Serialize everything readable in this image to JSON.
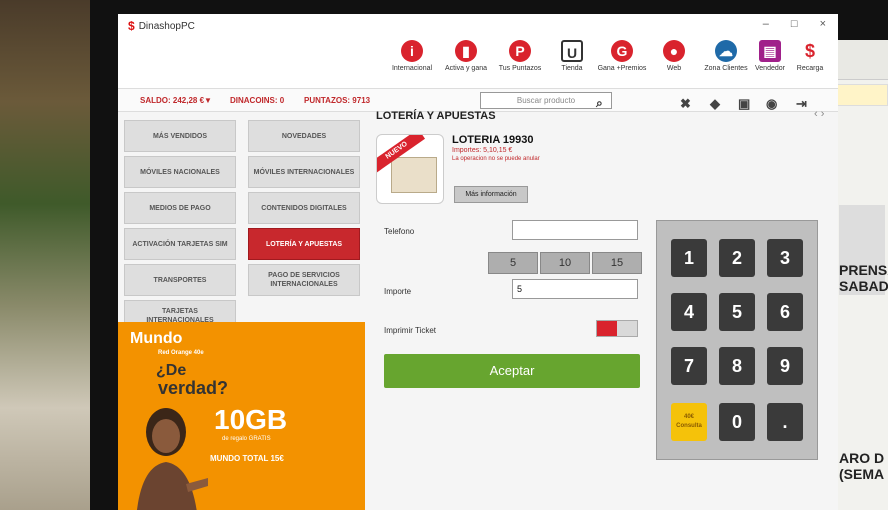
{
  "app": {
    "title": "DinashopPC",
    "logo_char": "$"
  },
  "window_controls": [
    "–",
    "□",
    "×"
  ],
  "toolbar": [
    {
      "label": "Internacional",
      "icon": "globe-phone-icon",
      "color": "#d9232d",
      "glyph": "i"
    },
    {
      "label": "Activa y gana",
      "icon": "trophy-icon",
      "color": "#d9232d",
      "glyph": "▮"
    },
    {
      "label": "Tus Puntazos",
      "icon": "points-icon",
      "color": "#d9232d",
      "glyph": "P"
    },
    {
      "label": "Tienda",
      "icon": "store-bag-icon",
      "color": "#333333",
      "glyph": "U"
    },
    {
      "label": "Gana +Premios",
      "icon": "gpx-icon",
      "color": "#d9232d",
      "glyph": "G"
    },
    {
      "label": "Web",
      "icon": "web-icon",
      "color": "#d9232d",
      "glyph": "●"
    },
    {
      "label": "Zona Clientes",
      "icon": "cloud-users-icon",
      "color": "#1f6aa8",
      "glyph": "☁"
    },
    {
      "label": "Vendedor",
      "icon": "shop-icon",
      "color": "#a0208a",
      "glyph": "▤"
    },
    {
      "label": "Recarga",
      "icon": "dollar-icon",
      "color": "#d9232d",
      "glyph": "$"
    }
  ],
  "infobar": {
    "saldo": "SALDO: 242,28 €▼",
    "dinacoins": "DINACOINS: 0",
    "puntazos": "PUNTAZOS: 9713",
    "search_placeholder": "Buscar producto"
  },
  "menu": [
    {
      "label": "MÁS VENDIDOS",
      "active": false
    },
    {
      "label": "NOVEDADES",
      "active": false
    },
    {
      "label": "MÓVILES NACIONALES",
      "active": false
    },
    {
      "label": "MÓVILES INTERNACIONALES",
      "active": false
    },
    {
      "label": "MEDIOS DE PAGO",
      "active": false
    },
    {
      "label": "CONTENIDOS DIGITALES",
      "active": false
    },
    {
      "label": "ACTIVACIÓN TARJETAS SIM",
      "active": false
    },
    {
      "label": "LOTERÍA Y APUESTAS",
      "active": true
    },
    {
      "label": "TRANSPORTES",
      "active": false
    },
    {
      "label": "PAGO DE SERVICIOS INTERNACIONALES",
      "active": false
    },
    {
      "label": "TARJETAS INTERNACIONALES",
      "active": false
    }
  ],
  "promo": {
    "brand": "Mundo",
    "sub": "Red Orange 40e",
    "q1": "¿De",
    "q2": "verdad?",
    "gb": "10GB",
    "gbsub": "de regalo GRATIS",
    "price": "MUNDO TOTAL 15€"
  },
  "section": {
    "title": "LOTERÍA Y APUESTAS",
    "arrows": "‹ ›"
  },
  "product": {
    "ribbon": "NUEVO",
    "name": "LOTERIA 19930",
    "importes": "Importes: 5,10,15 €",
    "operation_note": "La operacion no se puede anular",
    "more_button": "Más información"
  },
  "form": {
    "telefono_label": "Telefono",
    "telefono_value": "",
    "amounts": [
      "5",
      "10",
      "15"
    ],
    "importe_label": "Importe",
    "importe_value": "5",
    "ticket_label": "Imprimir Ticket",
    "accept_button": "Aceptar"
  },
  "keypad": {
    "keys": [
      "1",
      "2",
      "3",
      "4",
      "5",
      "6",
      "7",
      "8",
      "9",
      "40€ Consulta",
      "0",
      "."
    ]
  },
  "right_window": {
    "texts": [
      "PRENSA",
      "SABADO",
      "ARO D",
      "(SEMA"
    ]
  }
}
